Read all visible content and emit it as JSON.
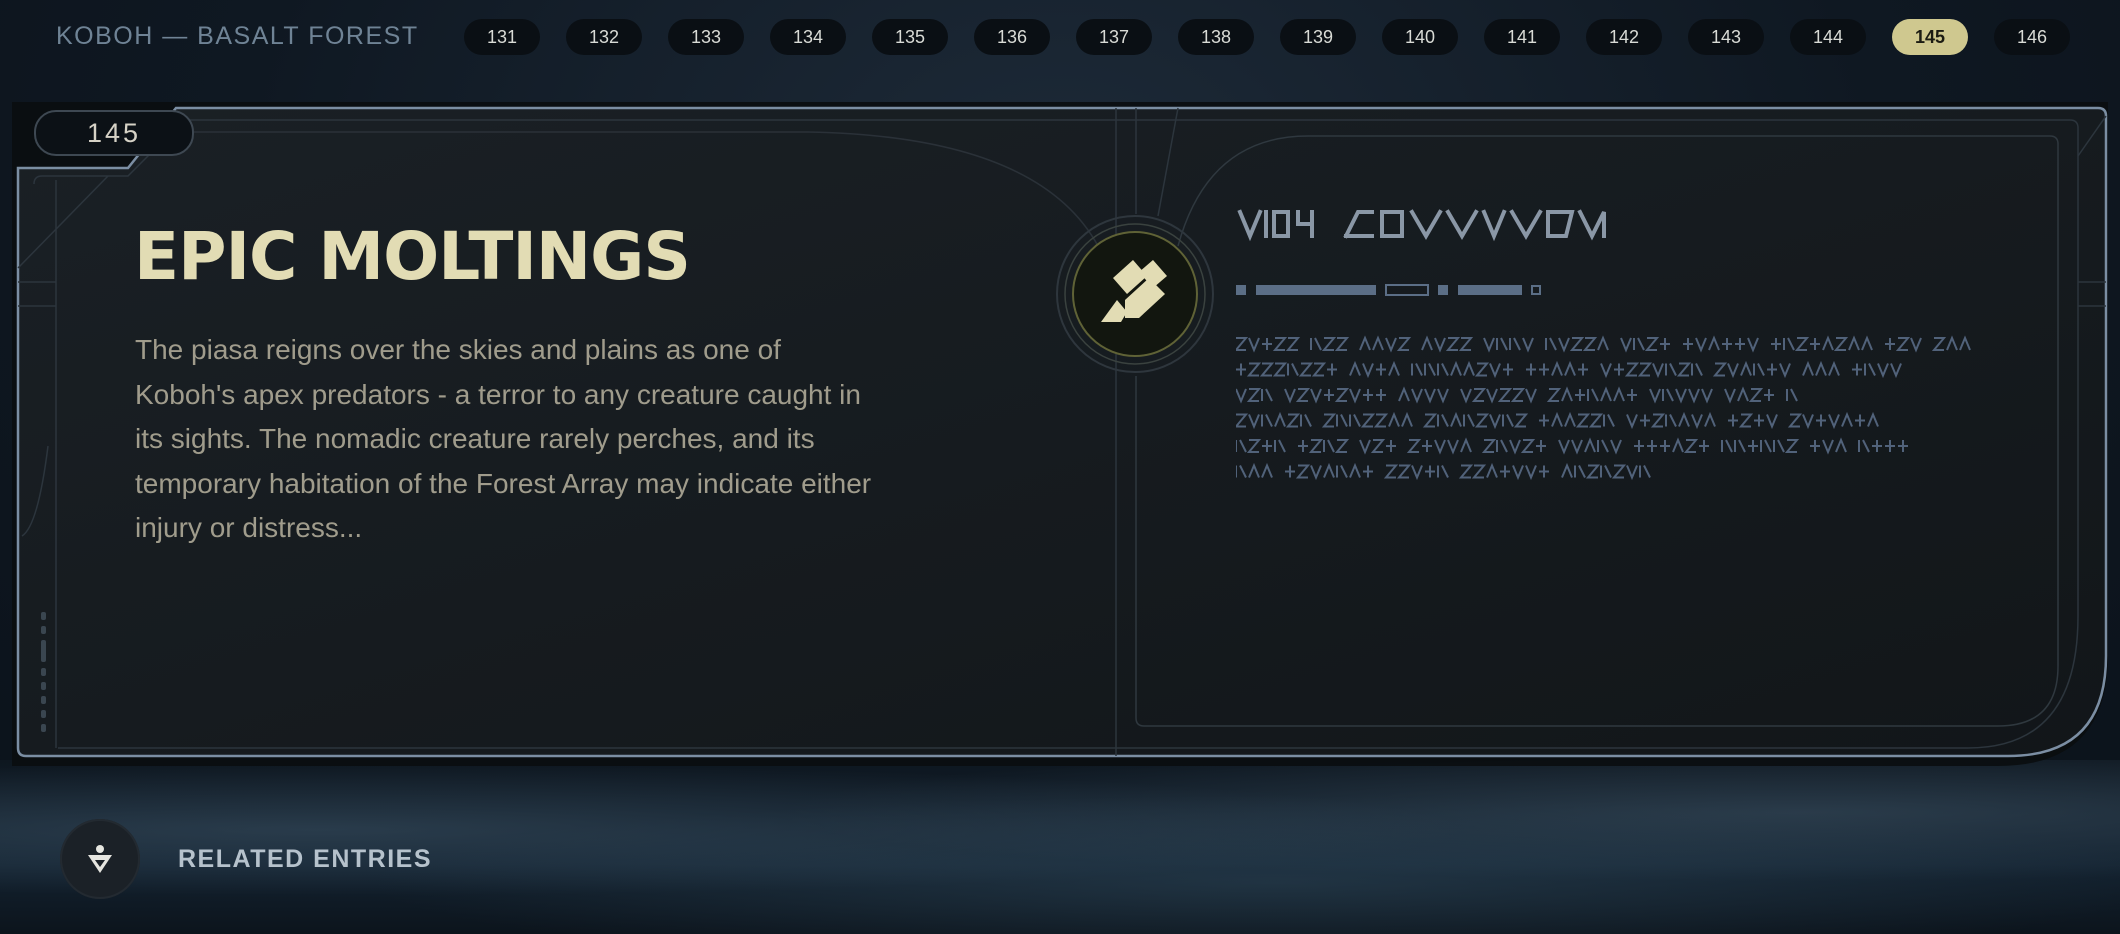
{
  "header": {
    "location": "KOBOH — BASALT FOREST",
    "entries": [
      "131",
      "132",
      "133",
      "134",
      "135",
      "136",
      "137",
      "138",
      "139",
      "140",
      "141",
      "142",
      "143",
      "144",
      "145",
      "146"
    ],
    "active_entry": "145"
  },
  "entry": {
    "number": "145",
    "title": "EPIC MOLTINGS",
    "description": "The piasa reigns over the skies and plains as one of Koboh's apex predators - a terror to any creature caught in its sights. The nomadic creature rarely perches, and its temporary habitation of the Forest Array may indicate either injury or distress..."
  },
  "related": {
    "label": "RELATED ENTRIES"
  },
  "colors": {
    "accent": "#cfc88f",
    "title": "#e2dcb4",
    "frame": "#6e8296",
    "aurebesh": "#5b6e86"
  }
}
